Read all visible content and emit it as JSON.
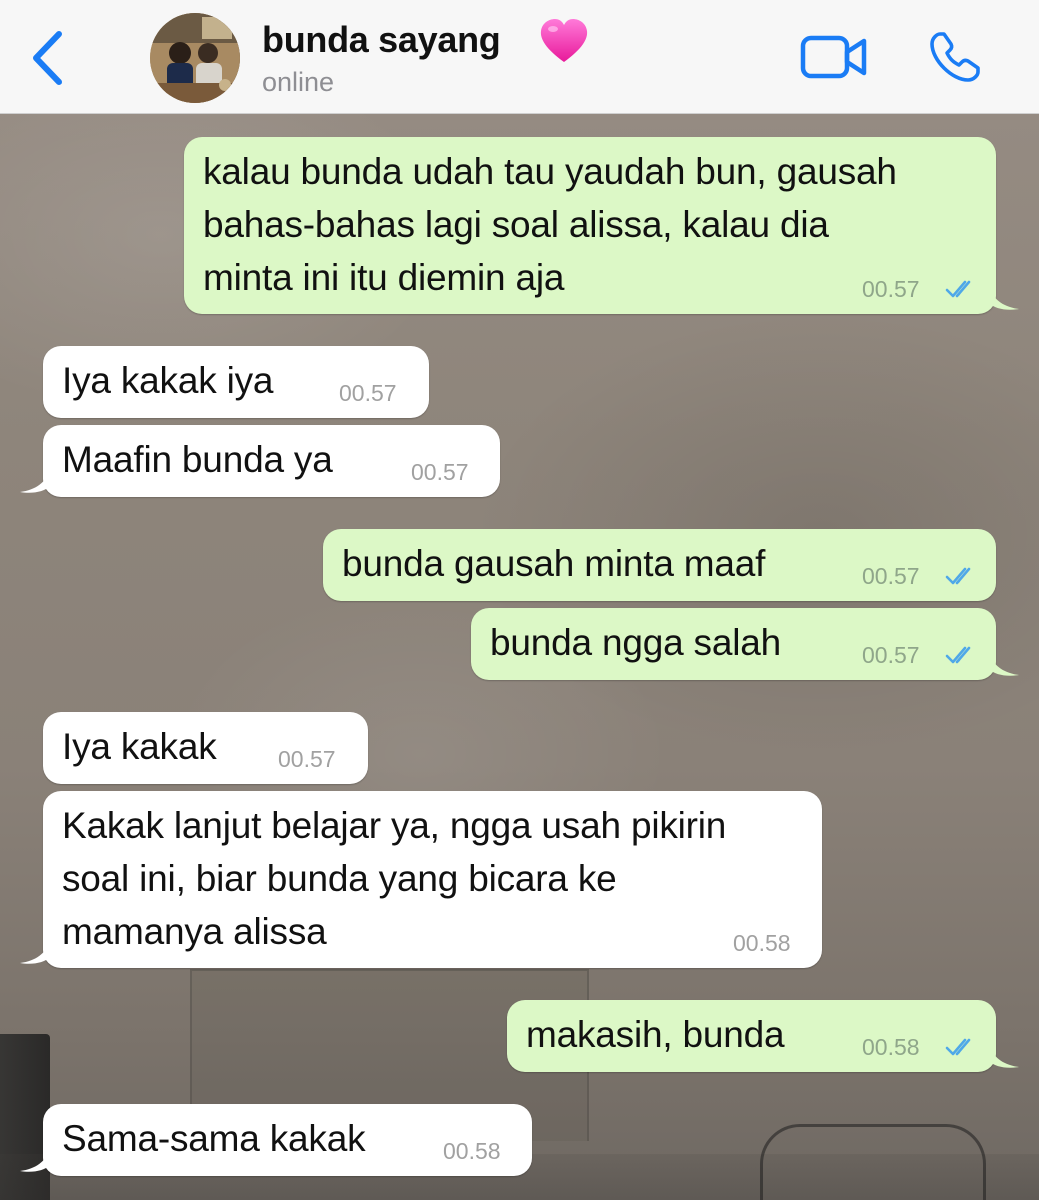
{
  "header": {
    "back_icon": "chevron-left-icon",
    "contact_name": "bunda sayang",
    "name_emoji": "pink-heart-icon",
    "status": "online",
    "video_icon": "video-camera-icon",
    "call_icon": "phone-icon"
  },
  "colors": {
    "accent": "#1a7cf5",
    "outgoing_bubble": "#dcf8c6",
    "incoming_bubble": "#ffffff",
    "read_ticks": "#4fa8e8"
  },
  "messages": [
    {
      "direction": "out",
      "text": "kalau bunda udah tau yaudah bun, gausah\nbahas-bahas lagi soal alissa, kalau dia\nminta ini itu diemin aja",
      "time": "00.57",
      "read": true
    },
    {
      "direction": "in",
      "text": "Iya kakak iya",
      "time": "00.57"
    },
    {
      "direction": "in",
      "text": "Maafin bunda ya",
      "time": "00.57"
    },
    {
      "direction": "out",
      "text": "bunda gausah minta maaf",
      "time": "00.57",
      "read": true
    },
    {
      "direction": "out",
      "text": "bunda ngga salah",
      "time": "00.57",
      "read": true
    },
    {
      "direction": "in",
      "text": "Iya kakak",
      "time": "00.57"
    },
    {
      "direction": "in",
      "text": "Kakak lanjut belajar ya, ngga usah pikirin\nsoal ini, biar bunda yang bicara ke\nmamanya alissa",
      "time": "00.58"
    },
    {
      "direction": "out",
      "text": "makasih, bunda",
      "time": "00.58",
      "read": true
    },
    {
      "direction": "in",
      "text": "Sama-sama kakak",
      "time": "00.58"
    }
  ]
}
